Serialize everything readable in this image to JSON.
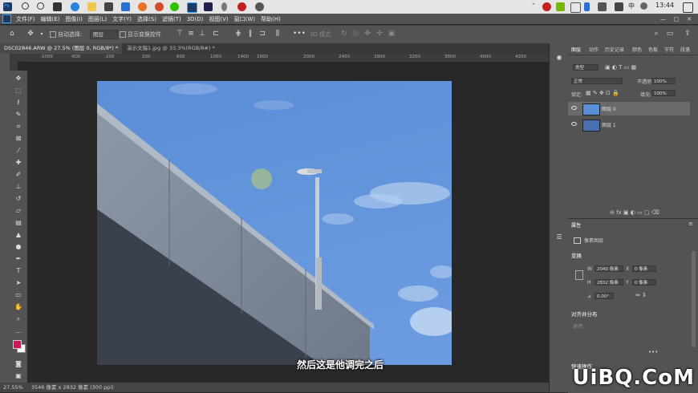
{
  "taskbar": {
    "clock": "13:44",
    "ime": "中",
    "ps_label": "Ps"
  },
  "menu": [
    "文件(F)",
    "编辑(E)",
    "图像(I)",
    "图层(L)",
    "文字(Y)",
    "选择(S)",
    "滤镜(T)",
    "3D(D)",
    "视图(V)",
    "窗口(W)",
    "帮助(H)"
  ],
  "options": {
    "auto_select_label": "自动选择:",
    "auto_select_value": "图层",
    "show_transform_label": "显示变换控件",
    "mode_3d_label": "3D 模式:"
  },
  "tabs": [
    {
      "label": "DSC02846.ARW @ 27.5% (图层 0, RGB/8*) *",
      "active": true
    },
    {
      "label": "演示文稿1.jpg @ 33.3%(RGB/8#) *",
      "active": false
    }
  ],
  "ruler_ticks": [
    "-1000",
    "-600",
    "-200",
    "200",
    "600",
    "1000",
    "1400",
    "1600",
    "2000",
    "2400",
    "2800",
    "3200",
    "3600",
    "4000",
    "4200"
  ],
  "status": {
    "zoom": "27.55%",
    "doc_info": "3546 像素 x 2832 像素 (300 ppi)"
  },
  "layers_panel": {
    "tabs": [
      "图层",
      "动作",
      "历史记录",
      "颜色",
      "色板",
      "字符",
      "段落"
    ],
    "filter_label": "类型",
    "blend_mode": "正常",
    "opacity_label": "不透明度:",
    "opacity_value": "100%",
    "lock_label": "锁定:",
    "fill_label": "填充:",
    "fill_value": "100%",
    "layers": [
      {
        "name": "图层 0",
        "selected": true
      },
      {
        "name": "图层 1",
        "selected": false
      }
    ]
  },
  "properties_panel": {
    "title": "属性",
    "kind": "像素图层",
    "transform_title": "变换",
    "w_label": "W",
    "w_value": "2040 像素",
    "x_label": "X",
    "x_value": "0 像素",
    "h_label": "H",
    "h_value": "2832 像素",
    "y_label": "Y",
    "y_value": "0 像素",
    "angle_value": "0.00°",
    "align_title": "对齐并分布",
    "align_sub": "对齐:",
    "quick_title": "快速操作"
  },
  "subtitle": "然后这是他调完之后",
  "watermark": "UiBQ.CoM",
  "colors": {
    "foreground": "#d4145a",
    "background": "#ffffff",
    "sky": "#5b8fd6",
    "panel": "#535353"
  }
}
